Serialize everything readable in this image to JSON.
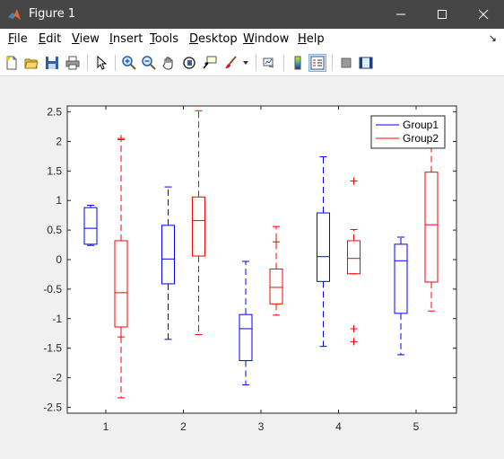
{
  "window": {
    "title": "Figure 1",
    "minimize_glyph": "—",
    "maximize_glyph": "☐",
    "close_glyph": "✕"
  },
  "menu": {
    "items": [
      {
        "label": "File",
        "accel": "F",
        "rest": "ile"
      },
      {
        "label": "Edit",
        "accel": "E",
        "rest": "dit"
      },
      {
        "label": "View",
        "accel": "V",
        "rest": "iew"
      },
      {
        "label": "Insert",
        "accel": "I",
        "rest": "nsert"
      },
      {
        "label": "Tools",
        "accel": "T",
        "rest": "ools"
      },
      {
        "label": "Desktop",
        "accel": "D",
        "rest": "esktop"
      },
      {
        "label": "Window",
        "accel": "W",
        "rest": "indow"
      },
      {
        "label": "Help",
        "accel": "H",
        "rest": "elp"
      }
    ],
    "overflow_glyph": "↘"
  },
  "toolbar": {
    "icons": [
      "new-figure-icon",
      "open-file-icon",
      "save-icon",
      "print-icon",
      "pointer-icon",
      "zoom-in-icon",
      "zoom-out-icon",
      "pan-icon",
      "rotate-3d-icon",
      "data-cursor-icon",
      "brush-icon",
      "brush-dropdown-icon",
      "link-plot-icon",
      "colorbar-icon",
      "legend-icon",
      "hide-plot-tools-icon",
      "show-plot-tools-icon"
    ]
  },
  "colors": {
    "group1": "#0000ff",
    "group2": "#ff0000",
    "axes": "#262626"
  },
  "chart_data": {
    "type": "box",
    "categories": [
      "1",
      "2",
      "3",
      "4",
      "5"
    ],
    "ylim": [
      -2.6,
      2.6
    ],
    "yticks": [
      -2.5,
      -2,
      -1.5,
      -1,
      -0.5,
      0,
      0.5,
      1,
      1.5,
      2,
      2.5
    ],
    "ytick_labels": [
      "-2.5",
      "-2",
      "-1.5",
      "-1",
      "-0.5",
      "0",
      "0.5",
      "1",
      "1.5",
      "2",
      "2.5"
    ],
    "legend_position": "top-right",
    "grid": false,
    "series": [
      {
        "name": "Group1",
        "color": "#0000ff",
        "boxes": [
          {
            "category": "1",
            "whisker_low": 0.24,
            "q1": 0.26,
            "median": 0.53,
            "q3": 0.88,
            "whisker_high": 0.92,
            "outliers": []
          },
          {
            "category": "2",
            "whisker_low": -1.35,
            "q1": -0.41,
            "median": 0.01,
            "q3": 0.58,
            "whisker_high": 1.23,
            "outliers": []
          },
          {
            "category": "3",
            "whisker_low": -2.12,
            "q1": -1.71,
            "median": -1.17,
            "q3": -0.93,
            "whisker_high": -0.03,
            "outliers": []
          },
          {
            "category": "4",
            "whisker_low": -1.47,
            "q1": -0.37,
            "median": 0.05,
            "q3": 0.79,
            "whisker_high": 1.74,
            "outliers": []
          },
          {
            "category": "5",
            "whisker_low": -1.61,
            "q1": -0.91,
            "median": -0.02,
            "q3": 0.26,
            "whisker_high": 0.38,
            "outliers": []
          }
        ]
      },
      {
        "name": "Group2",
        "color": "#ff0000",
        "boxes": [
          {
            "category": "1",
            "whisker_low": -2.34,
            "q1": -1.14,
            "median": -0.56,
            "q3": 0.32,
            "whisker_high": 2.03,
            "outliers": [
              2.05,
              -1.31
            ]
          },
          {
            "category": "2",
            "whisker_low": -1.27,
            "q1": 0.06,
            "median": 0.66,
            "q3": 1.06,
            "whisker_high": 2.52,
            "outliers": []
          },
          {
            "category": "3",
            "whisker_low": -0.94,
            "q1": -0.75,
            "median": -0.47,
            "q3": -0.16,
            "whisker_high": 0.56,
            "outliers": [
              0.3
            ]
          },
          {
            "category": "4",
            "whisker_low": -0.24,
            "q1": -0.24,
            "median": 0.02,
            "q3": 0.32,
            "whisker_high": 0.51,
            "outliers": [
              1.33,
              -1.17,
              -1.39
            ]
          },
          {
            "category": "5",
            "whisker_low": -0.87,
            "q1": -0.38,
            "median": 0.59,
            "q3": 1.48,
            "whisker_high": 1.93,
            "outliers": []
          }
        ]
      }
    ]
  }
}
